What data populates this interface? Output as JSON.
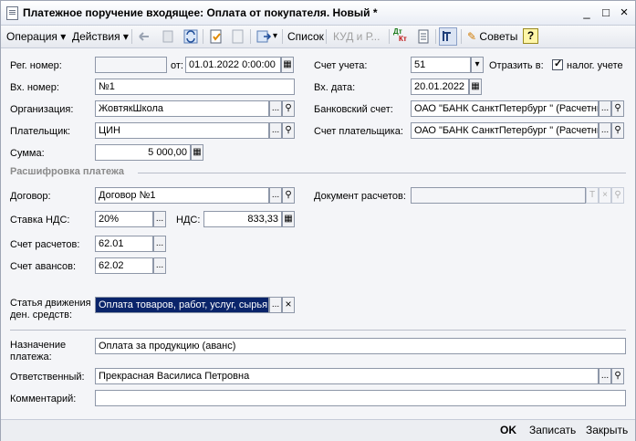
{
  "window": {
    "title": "Платежное поручение входящее: Оплата от покупателя. Новый *",
    "controls": [
      "_",
      "□",
      "×"
    ]
  },
  "toolbar": {
    "operation": "Операция",
    "actions": "Действия",
    "list": "Список",
    "kud": "КУД и Р...",
    "dtkt_top": "Дт",
    "dtkt_bottom": "Кт",
    "tips": "Советы",
    "help": "?",
    "dropdown_arrow": "▾"
  },
  "form": {
    "reg_number_label": "Рег. номер:",
    "reg_number_value": "",
    "from_label": "от:",
    "from_value": "01.01.2022  0:00:00",
    "in_number_label": "Вх. номер:",
    "in_number_value": "№1",
    "org_label": "Организация:",
    "org_value": "ЖовтякШкола",
    "payer_label": "Плательщик:",
    "payer_value": "ЦИН",
    "sum_label": "Сумма:",
    "sum_value": "5 000,00",
    "account_label": "Счет учета:",
    "account_value": "51",
    "reflect_label": "Отразить в:",
    "tax_label": "налог. учете",
    "in_date_label": "Вх. дата:",
    "in_date_value": "20.01.2022",
    "bank_label": "Банковский счет:",
    "bank_value": "ОАО \"БАНК СанктПетербург \" (Расчетный)",
    "payer_acc_label": "Счет плательщика:",
    "payer_acc_value": "ОАО \"БАНК СанктПетербург \" (Расчетный)",
    "section_title": "Расшифровка платежа",
    "contract_label": "Договор:",
    "contract_value": "Договор №1",
    "doc_label": "Документ расчетов:",
    "doc_value": "",
    "vat_rate_label": "Ставка НДС:",
    "vat_rate_value": "20%",
    "vat_label": "НДС:",
    "vat_value": "833,33",
    "calc_acc_label": "Счет расчетов:",
    "calc_acc_value": "62.01",
    "adv_acc_label": "Счет авансов:",
    "adv_acc_value": "62.02",
    "cashflow_label_1": "Статья движения",
    "cashflow_label_2": "ден. средств:",
    "cashflow_value": "Оплата товаров, работ, услуг, сырья",
    "purpose_label_1": "Назначение",
    "purpose_label_2": "платежа:",
    "purpose_value": "Оплата за продукцию (аванс)",
    "responsible_label": "Ответственный:",
    "responsible_value": "Прекрасная Василиса Петровна",
    "comment_label": "Комментарий:",
    "comment_value": ""
  },
  "buttons": {
    "ok": "OK",
    "save": "Записать",
    "close": "Закрыть",
    "select": "...",
    "search": "🔍",
    "clear": "×",
    "T": "T",
    "dropdown": "▾"
  }
}
